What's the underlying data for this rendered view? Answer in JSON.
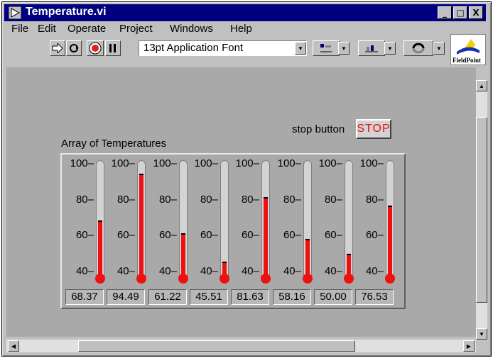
{
  "window": {
    "title": "Temperature.vi",
    "controls": [
      "_",
      "□",
      "X"
    ]
  },
  "menu": [
    "File",
    "Edit",
    "Operate",
    "Project",
    "Windows",
    "Help"
  ],
  "toolbar": {
    "font_select": "13pt Application Font"
  },
  "logo": {
    "text": "FieldPoint"
  },
  "front_panel": {
    "stop_label": "stop button",
    "stop_button": "STOP",
    "array_label": "Array of Temperatures",
    "scale_ticks": [
      "100",
      "80",
      "60",
      "40"
    ],
    "scale_min": 40,
    "scale_max": 100,
    "temperatures": [
      "68.37",
      "94.49",
      "61.22",
      "45.51",
      "81.63",
      "58.16",
      "50.00",
      "76.53"
    ],
    "colors": {
      "mercury": "#ef1010",
      "stop_text": "#e01010",
      "panel": "#a9a9a9"
    }
  }
}
